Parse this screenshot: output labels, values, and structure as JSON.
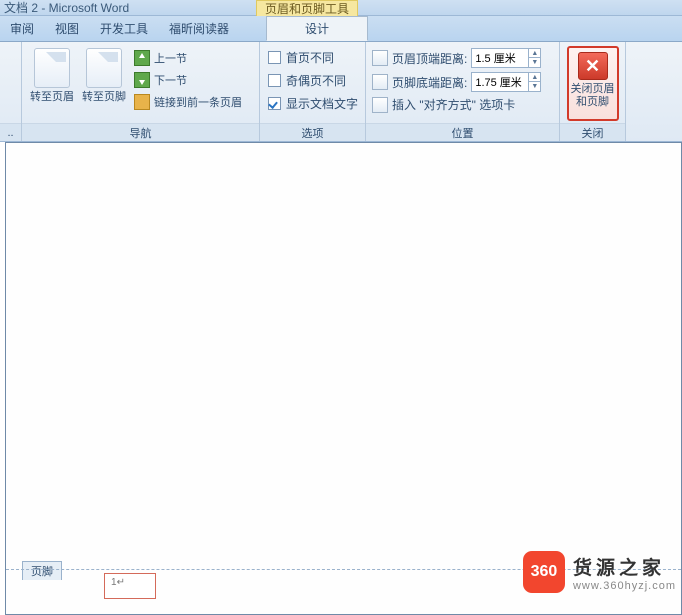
{
  "title_bar": {
    "doc_title": "文档 2 - Microsoft Word",
    "contextual_title": "页眉和页脚工具"
  },
  "tabs": {
    "review": "审阅",
    "view": "视图",
    "dev": "开发工具",
    "foxit": "福昕阅读器",
    "design": "设计"
  },
  "nav_group": {
    "label": "导航",
    "goto_header": "转至页眉",
    "goto_footer": "转至页脚",
    "prev_section": "上一节",
    "next_section": "下一节",
    "link_prev": "链接到前一条页眉"
  },
  "options_group": {
    "label": "选项",
    "diff_first": "首页不同",
    "diff_oddeven": "奇偶页不同",
    "show_doc_text": "显示文档文字"
  },
  "position_group": {
    "label": "位置",
    "header_from_top": "页眉顶端距离:",
    "footer_from_bottom": "页脚底端距离:",
    "insert_align_tab": "插入 \"对齐方式\" 选项卡",
    "header_val": "1.5 厘米",
    "footer_val": "1.75 厘米"
  },
  "close_group": {
    "label": "关闭",
    "close_btn_l1": "关闭页眉",
    "close_btn_l2": "和页脚"
  },
  "document": {
    "footer_tag": "页脚",
    "page_num": "1"
  },
  "watermark": {
    "badge": "360",
    "title": "货源之家",
    "url": "www.360hyzj.com"
  }
}
